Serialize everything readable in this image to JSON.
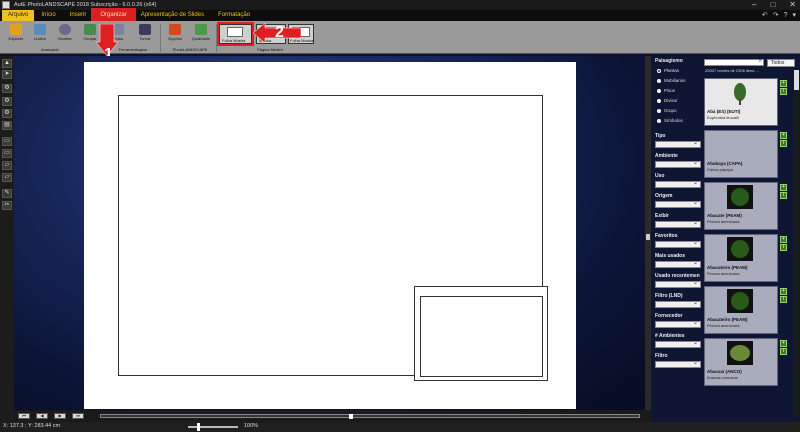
{
  "window": {
    "title": "AutE PhotoLANDSCAPE 2018 Subscrição - 6.0.0.26 (x64)",
    "controls": [
      "–",
      "□",
      "✕"
    ]
  },
  "menu": {
    "items": [
      "Arquivo",
      "Início",
      "Inserir",
      "Organizar",
      "Apresentação de Slides",
      "Formatação"
    ],
    "active": "Organizar",
    "right_tools": [
      "↶",
      "↷",
      "?",
      "▾"
    ]
  },
  "ribbon": {
    "buttons": [
      {
        "label": "Explorer",
        "color": "#e0a020"
      },
      {
        "label": "Lixeira",
        "color": "#5a8ac0"
      },
      {
        "label": "Mostrar",
        "color": "#6a6a8a"
      },
      {
        "label": "Ocupar",
        "color": "#4a8a4a"
      },
      {
        "label": "Fotos",
        "color": "#8080a0"
      },
      {
        "label": "Tornar",
        "color": "#3a3a5a"
      },
      {
        "label": "Opções",
        "color": "#d04a20"
      },
      {
        "label": "Qualidade",
        "color": "#4a9a4a"
      },
      {
        "label": "Folha Mostra",
        "color": "#ffffff"
      },
      {
        "label": "Mostra",
        "color": "#ffffff"
      },
      {
        "label": "Folha Mostra",
        "color": "#ffffff"
      }
    ],
    "groups": [
      "Avançado",
      "Ferramentagem",
      "PhotoLANDSCAPE",
      "Página Mestre"
    ]
  },
  "markers": [
    {
      "number": "1",
      "color": "#e02020"
    },
    {
      "number": "2",
      "color": "#e02020"
    }
  ],
  "left_tools": [
    "▲",
    "➤",
    "⚙",
    "⚙",
    "⚙",
    "▤",
    "▭",
    "▭",
    "▱",
    "▱",
    "✎",
    "✂"
  ],
  "bottom_nav": [
    "⏮",
    "◀",
    "▶",
    "⏭"
  ],
  "status": {
    "coords": "X: 137.3 ; Y: 283.44 cm",
    "zoom": "100%",
    "zoom_fraction": 0.2
  },
  "library": {
    "section": "Paisagismo",
    "radios": [
      {
        "label": "Plantas",
        "selected": true
      },
      {
        "label": "Mobiliarios",
        "selected": false
      },
      {
        "label": "Pisos",
        "selected": false
      },
      {
        "label": "Divisor",
        "selected": false
      },
      {
        "label": "Grupo",
        "selected": false
      },
      {
        "label": "Símbolos",
        "selected": false
      }
    ],
    "filters": [
      "Tipo",
      "Ambiente",
      "Uso",
      "Origem",
      "Exibir",
      "Favoritos",
      "Mais usados",
      "Usado recentemen",
      "Filtro (LND)",
      "Fornecedor",
      "# Ambientes",
      "Filtro"
    ],
    "search_placeholder": "",
    "search_mode": "Todos",
    "result_count": "22007 nomes de 2306 itens ...",
    "items": [
      {
        "name": "Abá (ES) (EUTI)",
        "scientific": "Euphorbia tirucalli"
      },
      {
        "name": "Ababaya (CAPA)",
        "scientific": "Carica papaya"
      },
      {
        "name": "Abacate (PEAM)",
        "scientific": "Persea americana"
      },
      {
        "name": "Abacateiro (PEAM)",
        "scientific": "Persea americana"
      },
      {
        "name": "Abacateiro (PEAM)",
        "scientific": "Persea americana"
      },
      {
        "name": "Abacaxi (ANCO)",
        "scientific": "Ananas comosus"
      }
    ]
  }
}
